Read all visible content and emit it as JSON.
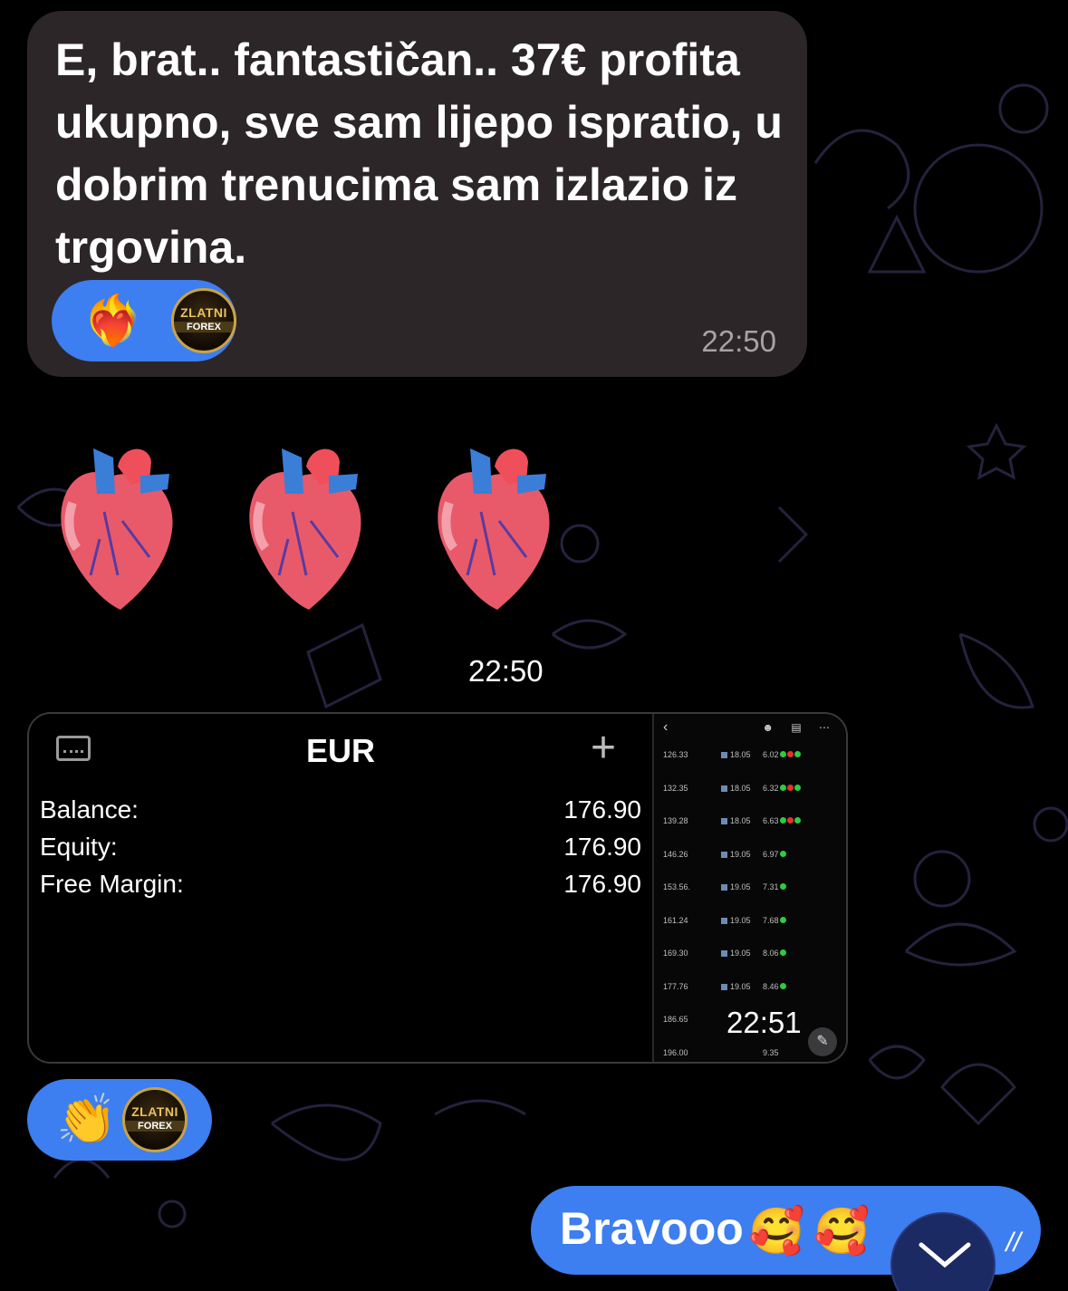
{
  "messages": {
    "incoming": {
      "text": "E, brat.. fantastičan.. 37€ profita ukupno, sve sam lijepo ispratio, u dobrim trenucima sam izlazio iz trgovina.",
      "time": "22:50",
      "reactions": {
        "emoji": "❤️‍🔥",
        "avatar_line1": "ZLATNI",
        "avatar_line2": "FOREX"
      }
    },
    "hearts": {
      "time": "22:50"
    },
    "album": {
      "time": "22:51",
      "account": {
        "currency": "EUR",
        "rows": [
          {
            "label": "Balance:",
            "value": "176.90"
          },
          {
            "label": "Equity:",
            "value": "176.90"
          },
          {
            "label": "Free Margin:",
            "value": "176.90"
          }
        ]
      },
      "trades": [
        {
          "price": "126.33",
          "date": "18.05",
          "size": "6.02",
          "dots": [
            "g",
            "r",
            "g"
          ]
        },
        {
          "price": "132.35",
          "date": "18.05",
          "size": "6.32",
          "dots": [
            "g",
            "r",
            "g"
          ]
        },
        {
          "price": "139.28",
          "date": "18.05",
          "size": "6.63",
          "dots": [
            "g",
            "r",
            "g"
          ]
        },
        {
          "price": "146.26",
          "date": "19.05",
          "size": "6.97",
          "dots": [
            "g"
          ]
        },
        {
          "price": "153.56.",
          "date": "19.05",
          "size": "7.31",
          "dots": [
            "g"
          ]
        },
        {
          "price": "161.24",
          "date": "19.05",
          "size": "7.68",
          "dots": [
            "g"
          ]
        },
        {
          "price": "169.30",
          "date": "19.05",
          "size": "8.06",
          "dots": [
            "g"
          ]
        },
        {
          "price": "177.76",
          "date": "19.05",
          "size": "8.46",
          "dots": [
            "g"
          ]
        },
        {
          "price": "186.65",
          "date": "",
          "size": "",
          "dots": []
        },
        {
          "price": "196.00",
          "date": "",
          "size": "9.35",
          "dots": []
        }
      ],
      "reactions": {
        "emoji": "👏",
        "avatar_line1": "ZLATNI",
        "avatar_line2": "FOREX"
      }
    },
    "outgoing": {
      "text": "Bravooo",
      "emoji": "🥰"
    }
  },
  "icons": {
    "card": "card-icon",
    "plus": "plus-icon",
    "back": "chevron-left-icon",
    "edit": "pencil-icon",
    "scroll": "chevron-down-icon"
  },
  "colors": {
    "bubble_in": "#2c2629",
    "bubble_out": "#3d7ef0",
    "reaction": "#3d7ef0",
    "background": "#000000"
  }
}
